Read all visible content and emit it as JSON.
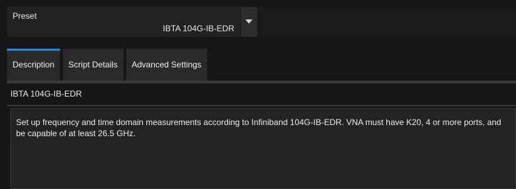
{
  "preset": {
    "label": "Preset",
    "value": "IBTA 104G-IB-EDR"
  },
  "tabs": [
    {
      "label": "Description",
      "active": true
    },
    {
      "label": "Script Details",
      "active": false
    },
    {
      "label": "Advanced Settings",
      "active": false
    }
  ],
  "content": {
    "title": "IBTA 104G-IB-EDR",
    "description": "Set up frequency and time domain measurements according to Infiniband 104G-IB-EDR. VNA must have K20, 4 or more ports, and be capable of at least 26.5 GHz."
  },
  "colors": {
    "accent": "#1e88e5",
    "background": "#161616",
    "panel": "#222222"
  }
}
